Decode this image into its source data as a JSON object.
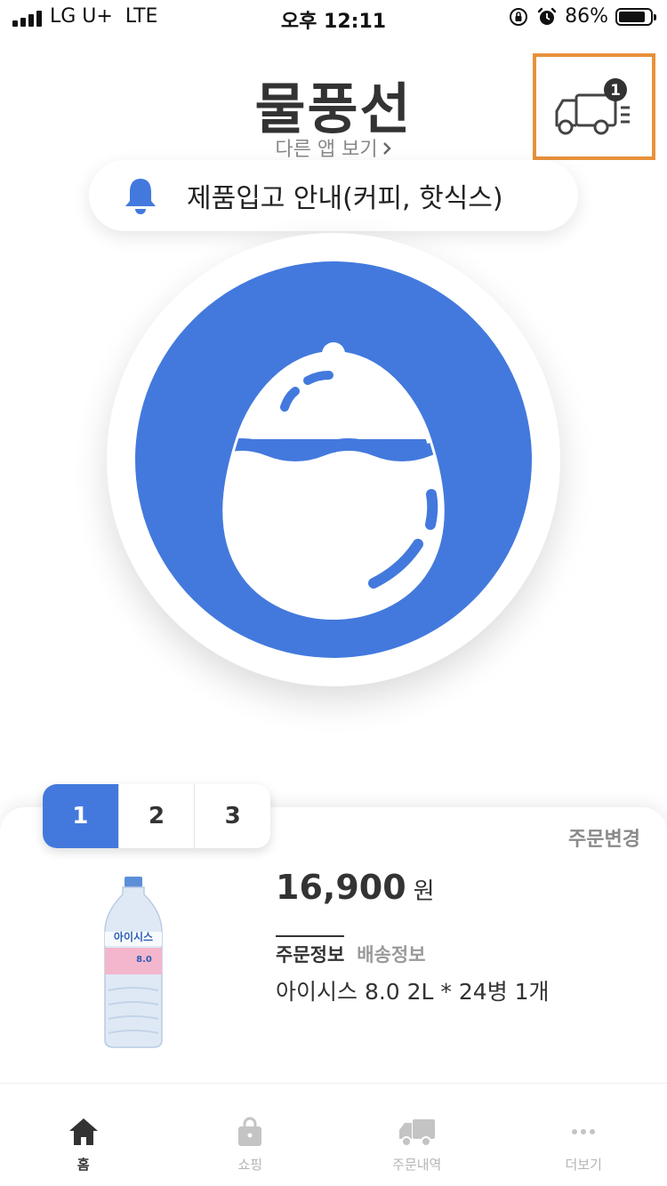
{
  "status_bar": {
    "carrier": "LG U+",
    "network": "LTE",
    "time": "오후 12:11",
    "battery_percent": "86%",
    "battery_level": 0.86
  },
  "header": {
    "title": "물풍선",
    "other_apps_link": "다른 앱 보기",
    "delivery_badge_count": "1"
  },
  "notice": {
    "text": "제품입고 안내(커피, 핫식스)"
  },
  "order": {
    "tabs": [
      "1",
      "2",
      "3"
    ],
    "change_label": "주문변경",
    "price": "16,900",
    "currency": "원",
    "info_tab_active": "주문정보",
    "info_tab_inactive": "배송정보",
    "detail": "아이시스 8.0 2L * 24병 1개",
    "product_label": "아이시스",
    "product_sub": "8.0"
  },
  "bottom_nav": [
    {
      "label": "홈",
      "icon": "home-icon",
      "active": true
    },
    {
      "label": "쇼핑",
      "icon": "shopping-bag-icon",
      "active": false
    },
    {
      "label": "주문내역",
      "icon": "truck-icon",
      "active": false
    },
    {
      "label": "더보기",
      "icon": "more-dots-icon",
      "active": false
    }
  ],
  "colors": {
    "accent": "#4379dd",
    "highlight_border": "#e8913b"
  }
}
